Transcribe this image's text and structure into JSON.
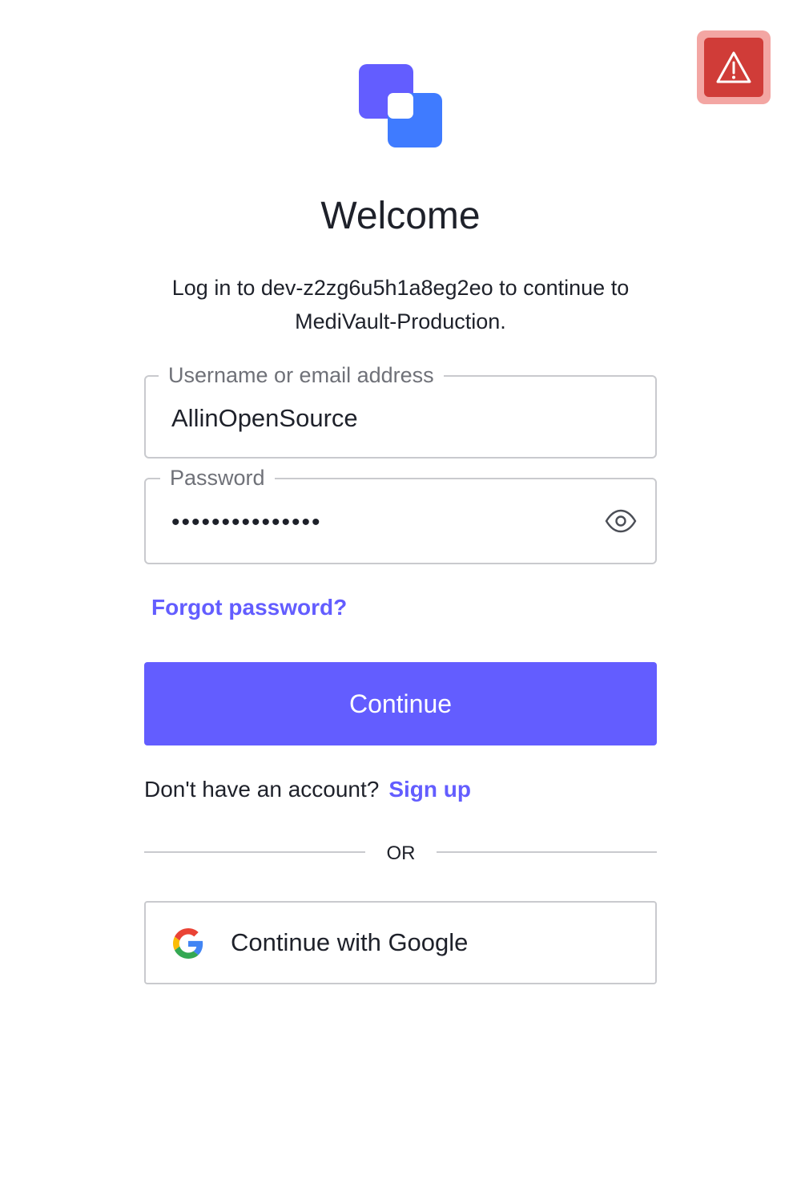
{
  "header": {
    "title": "Welcome",
    "subtitle": "Log in to dev-z2zg6u5h1a8eg2eo to continue to MediVault-Production."
  },
  "logo": {
    "icon": "brand-logo-icon",
    "colors": [
      "#635dff",
      "#3f7bff"
    ]
  },
  "warning_button": {
    "icon": "warning-triangle-icon",
    "color": "#d03c38"
  },
  "form": {
    "username": {
      "label": "Username or email address",
      "value": "AllinOpenSource"
    },
    "password": {
      "label": "Password",
      "masked_value": "•••••••••••••••",
      "toggle_icon": "eye-icon"
    },
    "forgot_password": "Forgot password?",
    "continue_label": "Continue"
  },
  "signup": {
    "prompt": "Don't have an account?",
    "link": "Sign up"
  },
  "divider": {
    "text": "OR"
  },
  "social": {
    "google_label": "Continue with Google",
    "google_icon": "google-icon"
  },
  "colors": {
    "accent": "#635dff",
    "text": "#1e212a",
    "muted": "#6f7178",
    "border": "#c9cace",
    "warning": "#d03c38"
  }
}
